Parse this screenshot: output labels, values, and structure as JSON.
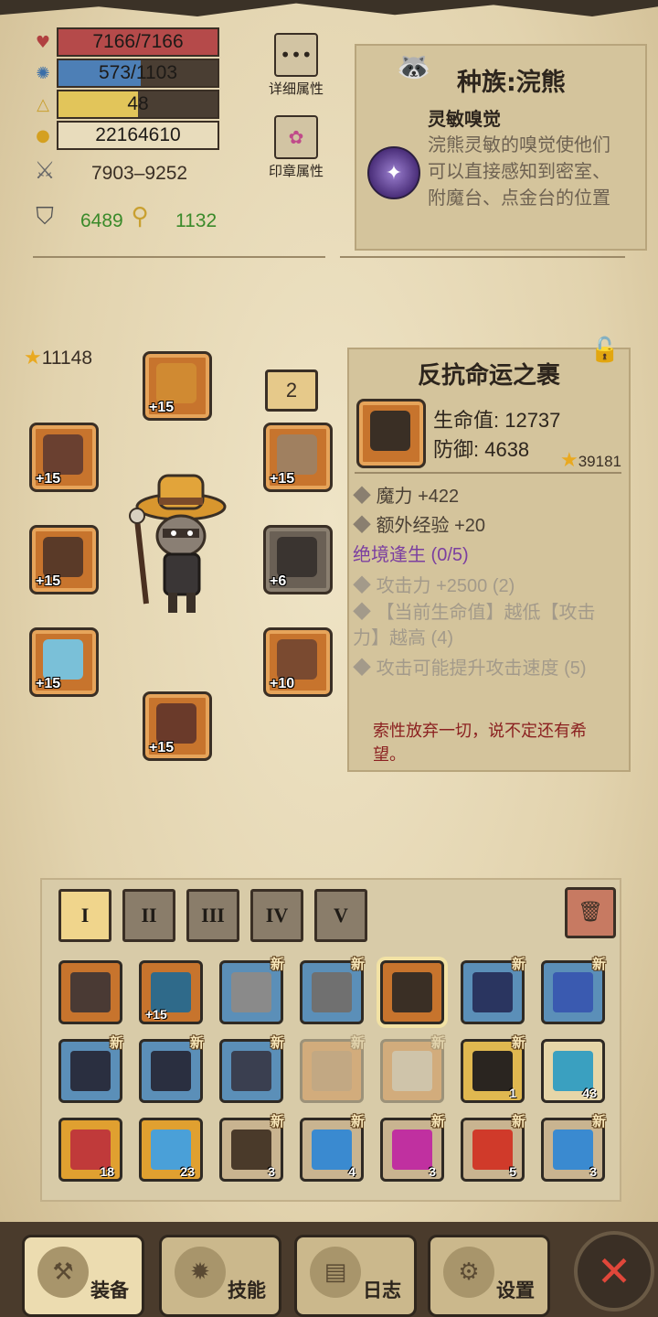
{
  "stats": {
    "hp": {
      "text": "7166/7166",
      "fill": 1.0,
      "color": "#b54a4a"
    },
    "mp": {
      "text": "573/1103",
      "fill": 0.52,
      "color": "#4d7fb6"
    },
    "level": {
      "text": "48",
      "fill": 0.5,
      "color": "#e2c55a"
    },
    "gold": {
      "text": "22164610"
    },
    "attack": "7903–9252",
    "defense": "6489",
    "magic": "1132"
  },
  "buttons": {
    "detail_attributes": "详细属性",
    "seal_attributes": "印章属性"
  },
  "race": {
    "title": "种族:浣熊",
    "skill_name": "灵敏嗅觉",
    "skill_desc": "浣熊灵敏的嗅觉使他们可以直接感知到密室、附魔台、点金台的位置"
  },
  "equipment": {
    "power": "11148",
    "badge": "2",
    "slots": [
      {
        "name": "helmet-slot",
        "plus": "+15",
        "color": "#d08a32"
      },
      {
        "name": "left-top-slot",
        "plus": "+15",
        "color": "#6a4030"
      },
      {
        "name": "weapon-slot",
        "plus": "+15",
        "color": "#5a3a28"
      },
      {
        "name": "ring-slot",
        "plus": "+15",
        "color": "#7ac0d8"
      },
      {
        "name": "amulet-slot",
        "plus": "+15",
        "color": "#6a3a2a"
      },
      {
        "name": "accessory-slot",
        "plus": "+15",
        "color": "#a08060"
      },
      {
        "name": "armor-slot",
        "plus": "+6",
        "color": "#3a3430"
      },
      {
        "name": "belt-slot",
        "plus": "+10",
        "color": "#7a4a30"
      }
    ]
  },
  "item": {
    "name": "反抗命运之裹",
    "hp": "生命值: 12737",
    "defense": "防御: 4638",
    "score": "39181",
    "bonuses": [
      "魔力 +422",
      "额外经验 +20"
    ],
    "set_name": "绝境逢生 (0/5)",
    "set_bonuses": [
      "攻击力 +2500 (2)",
      "【当前生命值】越低【攻击力】越高 (4)",
      "攻击可能提升攻击速度 (5)"
    ],
    "quote": "索性放弃一切，说不定还有希望。"
  },
  "inventory": {
    "tabs": [
      "I",
      "II",
      "III",
      "IV",
      "V"
    ],
    "new_label": "新",
    "rows": [
      [
        {
          "bg": "#c7742d",
          "art": "#4a3a34",
          "new": false,
          "count": "",
          "level": ""
        },
        {
          "bg": "#c7742d",
          "art": "#2f6a8a",
          "new": false,
          "count": "",
          "level": "+15"
        },
        {
          "bg": "#5b8fb8",
          "art": "#8a8a8a",
          "new": true,
          "count": "",
          "level": ""
        },
        {
          "bg": "#5b8fb8",
          "art": "#707070",
          "new": true,
          "count": "",
          "level": ""
        },
        {
          "bg": "#c7742d",
          "art": "#3a2f25",
          "new": false,
          "count": "",
          "level": "",
          "selected": true
        },
        {
          "bg": "#5b8fb8",
          "art": "#2a3560",
          "new": true,
          "count": "",
          "level": ""
        },
        {
          "bg": "#5b8fb8",
          "art": "#3a5ab0",
          "new": true,
          "count": "",
          "level": ""
        }
      ],
      [
        {
          "bg": "#5b8fb8",
          "art": "#2a2f40",
          "new": true,
          "count": "",
          "level": ""
        },
        {
          "bg": "#5b8fb8",
          "art": "#2a2f40",
          "new": true,
          "count": "",
          "level": ""
        },
        {
          "bg": "#5b8fb8",
          "art": "#3a3f50",
          "new": true,
          "count": "",
          "level": ""
        },
        {
          "bg": "#c7742d",
          "art": "#9a6a40",
          "new": true,
          "count": "",
          "level": "",
          "ghost": true
        },
        {
          "bg": "#c7742d",
          "art": "#c0b8b0",
          "new": true,
          "count": "",
          "level": "",
          "ghost": true
        },
        {
          "bg": "#e0b850",
          "art": "#2a2520",
          "new": true,
          "count": "1",
          "level": ""
        },
        {
          "bg": "#e6d6a8",
          "art": "#3aa0c0",
          "new": false,
          "count": "43",
          "level": ""
        }
      ],
      [
        {
          "bg": "#e0a030",
          "art": "#c03a3a",
          "new": false,
          "count": "18",
          "level": ""
        },
        {
          "bg": "#e0a030",
          "art": "#4aa0d8",
          "new": false,
          "count": "23",
          "level": ""
        },
        {
          "bg": "#c9b490",
          "art": "#4a3a2a",
          "new": true,
          "count": "3",
          "level": ""
        },
        {
          "bg": "#c9b490",
          "art": "#3a8ad0",
          "new": true,
          "count": "4",
          "level": ""
        },
        {
          "bg": "#c9b490",
          "art": "#c030a0",
          "new": true,
          "count": "3",
          "level": ""
        },
        {
          "bg": "#c9b490",
          "art": "#d03a2a",
          "new": true,
          "count": "5",
          "level": ""
        },
        {
          "bg": "#c9b490",
          "art": "#3a8ad0",
          "new": true,
          "count": "3",
          "level": ""
        }
      ]
    ]
  },
  "nav": {
    "equip": "装备",
    "skills": "技能",
    "log": "日志",
    "settings": "设置"
  }
}
